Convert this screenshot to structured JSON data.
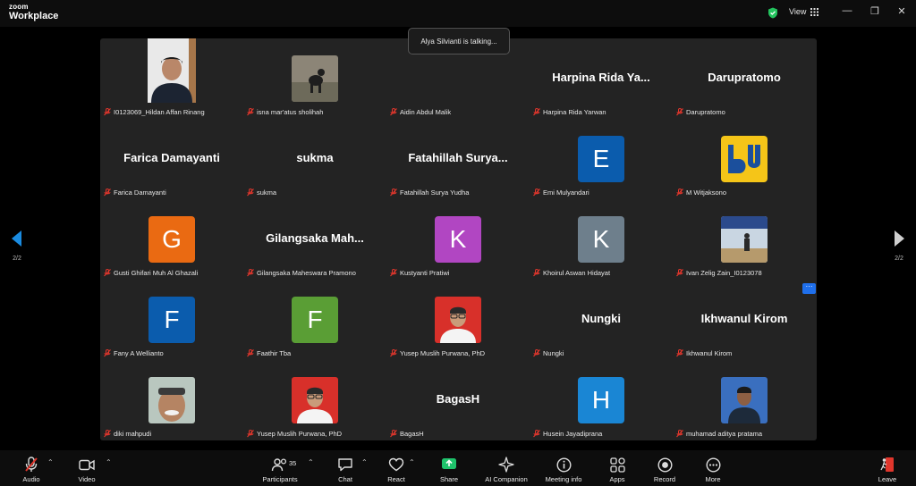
{
  "app": {
    "logo_line1": "zoom",
    "logo_line2": "Workplace",
    "view_label": "View"
  },
  "window_controls": {
    "minimize": "—",
    "restore": "❐",
    "close": "✕"
  },
  "toast": "Alya Silvianti is talking...",
  "pager": {
    "left": "2/2",
    "right": "2/2"
  },
  "tiles": [
    {
      "label": "I0123069_Hildan Affan Rinang",
      "kind": "video"
    },
    {
      "label": "isna mar'atus sholihah",
      "kind": "photo"
    },
    {
      "label": "Aidin Abdul Malik",
      "kind": "blank"
    },
    {
      "label": "Harpina Rida Yarwan",
      "kind": "name",
      "display": "Harpina Rida Ya..."
    },
    {
      "label": "Darupratomo",
      "kind": "name",
      "display": "Darupratomo"
    },
    {
      "label": "Farica Damayanti",
      "kind": "name",
      "display": "Farica Damayanti"
    },
    {
      "label": "sukma",
      "kind": "name",
      "display": "sukma"
    },
    {
      "label": "Fatahillah Surya Yudha",
      "kind": "name",
      "display": "Fatahillah Surya..."
    },
    {
      "label": "Emi Mulyandari",
      "kind": "avatar",
      "letter": "E",
      "color": "#0b5cad"
    },
    {
      "label": "M Witjaksono",
      "kind": "logo"
    },
    {
      "label": "Gusti Ghifari Muh Al Ghazali",
      "kind": "avatar",
      "letter": "G",
      "color": "#ea6a12"
    },
    {
      "label": "Gilangsaka Maheswara Pramono",
      "kind": "name",
      "display": "Gilangsaka Mah..."
    },
    {
      "label": "Kustyanti Pratiwi",
      "kind": "avatar",
      "letter": "K",
      "color": "#b146c2"
    },
    {
      "label": "Khoirul Aswan Hidayat",
      "kind": "avatar",
      "letter": "K",
      "color": "#6e7f8c"
    },
    {
      "label": "Ivan Zelig Zain_I0123078",
      "kind": "photo"
    },
    {
      "label": "Fany A Wellianto",
      "kind": "avatar",
      "letter": "F",
      "color": "#0b5cad"
    },
    {
      "label": "Faathir Tba",
      "kind": "avatar",
      "letter": "F",
      "color": "#5a9e35"
    },
    {
      "label": "Yusep Muslih Purwana, PhD",
      "kind": "portrait"
    },
    {
      "label": "Nungki",
      "kind": "name",
      "display": "Nungki"
    },
    {
      "label": "Ikhwanul Kirom",
      "kind": "name",
      "display": "Ikhwanul Kirom"
    },
    {
      "label": "diki mahpudi",
      "kind": "photo"
    },
    {
      "label": "Yusep Muslih Purwana, PhD",
      "kind": "portrait"
    },
    {
      "label": "BagasH",
      "kind": "name",
      "display": "BagasH"
    },
    {
      "label": "Husein Jayadiprana",
      "kind": "avatar",
      "letter": "H",
      "color": "#1a86d4"
    },
    {
      "label": "muhamad aditya pratama",
      "kind": "photo"
    }
  ],
  "toolbar": {
    "audio": "Audio",
    "video": "Video",
    "participants": "Participants",
    "participants_count": "35",
    "chat": "Chat",
    "react": "React",
    "share": "Share",
    "ai_companion": "AI Companion",
    "meeting_info": "Meeting info",
    "apps": "Apps",
    "record": "Record",
    "more": "More",
    "leave": "Leave"
  },
  "colors": {
    "share_green": "#1ec26b",
    "leave_red": "#e0362c",
    "accent_blue": "#1f6feb",
    "mute_red": "#e0362c"
  }
}
